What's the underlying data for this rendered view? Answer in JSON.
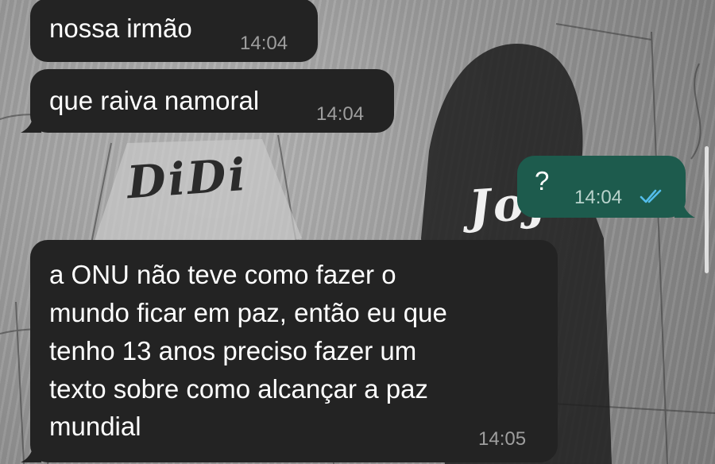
{
  "messages": [
    {
      "direction": "incoming",
      "text": "nossa irmão",
      "time": "14:04"
    },
    {
      "direction": "incoming",
      "text": "que raiva namoral",
      "time": "14:04"
    },
    {
      "direction": "outgoing",
      "text": "?",
      "time": "14:04",
      "status_icon": "double-check-read-icon"
    },
    {
      "direction": "incoming",
      "text": "a ONU não teve como fazer o\nmundo ficar em paz, então eu que\ntenho 13 anos preciso fazer um\ntexto sobre como alcançar a paz\nmundial",
      "time": "14:05"
    }
  ],
  "wallpaper": {
    "text_left": "DiDi",
    "text_right": "JoJo"
  },
  "colors": {
    "incoming_bubble": "#232323",
    "outgoing_bubble": "#1d5b4d",
    "read_receipt": "#53bdeb",
    "timestamp": "#9e9e9e"
  }
}
